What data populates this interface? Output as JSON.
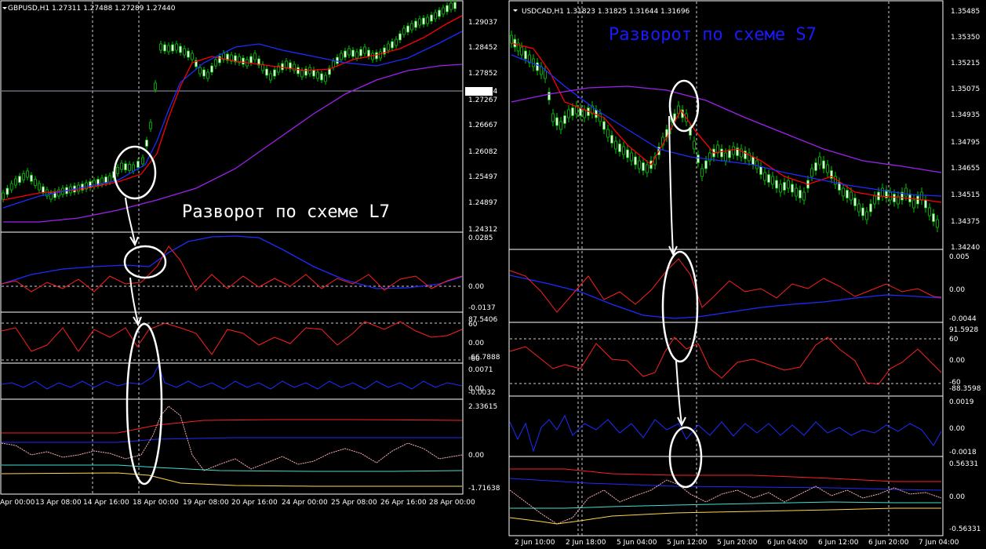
{
  "colors": {
    "background": "#000000",
    "divider": "#ffffff",
    "grid": "#cfcfcf",
    "text": "#ffffff",
    "bull_candle": "#ffffff",
    "bear_candle": "#000000",
    "wick": "#00c800",
    "ma_fast": "#ff0000",
    "ma_mid": "#1e2bff",
    "ma_slow": "#a020f0",
    "osc_red": "#ff2020",
    "osc_blue": "#1e2bff",
    "osc_cyan": "#40e0d0",
    "osc_yellow": "#ffd84a",
    "annotation_white": "#ffffff",
    "annotation_blue": "#1a1aff"
  },
  "charts": [
    {
      "id": "left",
      "header": "GBPUSD,H1  1.27311 1.27488 1.27289 1.27440",
      "annotation": "Разворот по схеме L7",
      "annotation_color": "white",
      "price_labels": [
        "1.29037",
        "1.28452",
        "1.27852",
        "1.27464",
        "1.27267",
        "1.26667",
        "1.26082",
        "1.25497",
        "1.24897",
        "1.24312"
      ],
      "current_price": "1.27464",
      "x_labels": [
        "Apr 00:00",
        "13 Apr 08:00",
        "14 Apr 16:00",
        "18 Apr 00:00",
        "19 Apr 08:00",
        "20 Apr 16:00",
        "24 Apr 00:00",
        "25 Apr 08:00",
        "26 Apr 16:00",
        "28 Apr 00:00"
      ],
      "panel_labels": [
        [
          "0.0285",
          "0.00",
          "-0.0137"
        ],
        [
          "87.5406",
          "60",
          "0.00",
          "-60",
          "-66.7888"
        ],
        [
          "0.0071",
          "0.00",
          "-0.0032"
        ],
        [
          "2.33615",
          "0.00",
          "-1.71638"
        ]
      ]
    },
    {
      "id": "right",
      "header": "USDCAD,H1  1.31823 1.31825 1.31644 1.31696",
      "annotation": "Разворот по схеме S7",
      "annotation_color": "blue",
      "price_labels": [
        "1.35485",
        "1.35350",
        "1.35215",
        "1.35075",
        "1.34935",
        "1.34795",
        "1.34655",
        "1.34515",
        "1.34375",
        "1.34240"
      ],
      "x_labels": [
        "2 Jun 10:00",
        "2 Jun 18:00",
        "5 Jun 04:00",
        "5 Jun 12:00",
        "5 Jun 20:00",
        "6 Jun 04:00",
        "6 Jun 12:00",
        "6 Jun 20:00",
        "7 Jun 04:00"
      ],
      "panel_labels": [
        [
          "0.005",
          "0.00",
          "-0.0044"
        ],
        [
          "91.5928",
          "60",
          "0.00",
          "-60",
          "-88.3598"
        ],
        [
          "0.0019",
          "0.00",
          "-0.0018"
        ],
        [
          "0.56331",
          "0.00",
          "-0.56331"
        ]
      ]
    }
  ]
}
